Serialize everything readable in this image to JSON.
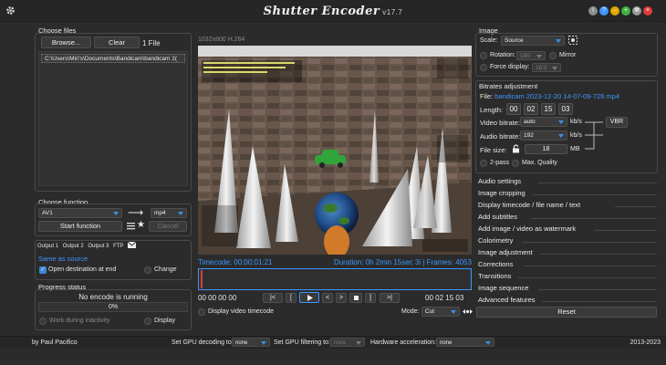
{
  "app": {
    "title": "Shutter Encoder",
    "version": "v17.7"
  },
  "choose_files": {
    "title": "Choose files",
    "browse_label": "Browse...",
    "clear_label": "Clear",
    "count_label": "1 File",
    "files": [
      "C:\\Users\\Miri's\\Documents\\Bandicam\\bandicam 2("
    ]
  },
  "choose_function": {
    "title": "Choose function",
    "function_value": "AV1",
    "container_value": "mp4",
    "start_label": "Start function",
    "cancel_label": "Cancel"
  },
  "output": {
    "tabs": [
      "Output 1",
      "Output 2",
      "Output 3",
      "FTP"
    ],
    "same_as_source": "Same as source",
    "open_destination": "Open destination at end",
    "change_label": "Change"
  },
  "progress": {
    "title": "Progress status",
    "status_text": "No encode is running",
    "percent_text": "0%",
    "percent": 0,
    "work_inactivity": "Work during inactivity",
    "display_label": "Display"
  },
  "preview": {
    "resolution_text": "1032x800 H.264",
    "timecode_text": "Timecode: 00:00:01:21",
    "duration_text": "Duration: 0h 2min 15sec 3i | Frames: 4053",
    "in_point": "00 00 00 00",
    "out_point": "00 02 15 03",
    "display_timecode": "Display video timecode",
    "mode_label": "Mode:",
    "mode_value": "Cut",
    "controls": [
      "|<",
      "[",
      "<",
      ">",
      "]",
      ">|"
    ]
  },
  "image": {
    "title": "Image",
    "scale_label": "Scale:",
    "scale_value": "Source",
    "rotation_label": "Rotation:",
    "rotation_value": "180",
    "mirror_label": "Mirror",
    "force_display_label": "Force display:",
    "force_display_value": "16:9"
  },
  "bitrates": {
    "title": "Bitrates adjustment",
    "file_label": "File:",
    "file_name": "bandicam 2023-12-20 14-07-09-728.mp4",
    "length_label": "Length:",
    "length_parts": [
      "00",
      "02",
      "15",
      "03"
    ],
    "video_bitrate_label": "Video bitrate:",
    "video_bitrate_value": "auto",
    "audio_bitrate_label": "Audio bitrate:",
    "audio_bitrate_value": "192",
    "unit_kbs": "kb/s",
    "file_size_label": "File size:",
    "file_size_value": "18",
    "unit_mb": "MB",
    "vbr_label": "VBR",
    "two_pass": "2-pass",
    "max_quality": "Max. Quality"
  },
  "categories": [
    "Audio settings",
    "Image cropping",
    "Display timecode / file name / text",
    "Add subtitles",
    "Add image / video as watermark",
    "Colorimetry",
    "Image adjustment",
    "Corrections",
    "Transitions",
    "Image sequence",
    "Advanced features"
  ],
  "reset_label": "Reset",
  "statusbar": {
    "author": "by Paul Pacifico",
    "gpu_decoding_label": "Set GPU decoding to:",
    "gpu_decoding_value": "none",
    "gpu_filtering_label": "Set GPU filtering to:",
    "gpu_filtering_value": "none",
    "hw_accel_label": "Hardware acceleration:",
    "hw_accel_value": "none",
    "copyright": "2013-2023"
  },
  "colors": {
    "accent": "#3d96ff",
    "background": "#2b2b2b",
    "title_bar": "#262626"
  }
}
